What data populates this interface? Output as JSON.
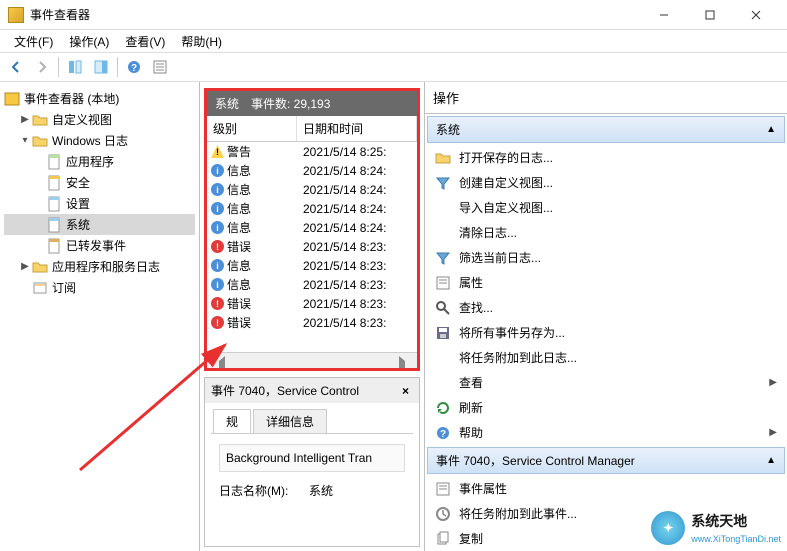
{
  "titlebar": {
    "title": "事件查看器"
  },
  "menubar": {
    "file": "文件(F)",
    "action": "操作(A)",
    "view": "查看(V)",
    "help": "帮助(H)"
  },
  "tree": {
    "root": "事件查看器 (本地)",
    "custom_views": "自定义视图",
    "windows_logs": "Windows 日志",
    "app_log": "应用程序",
    "security": "安全",
    "setup": "设置",
    "system": "系统",
    "forwarded": "已转发事件",
    "app_service_logs": "应用程序和服务日志",
    "subscriptions": "订阅"
  },
  "midheader": {
    "name": "系统",
    "count_label": "事件数: 29,193"
  },
  "columns": {
    "level": "级别",
    "datetime": "日期和时间"
  },
  "events": [
    {
      "lvl": "warn",
      "lvl_text": "警告",
      "dt": "2021/5/14 8:25:"
    },
    {
      "lvl": "info",
      "lvl_text": "信息",
      "dt": "2021/5/14 8:24:"
    },
    {
      "lvl": "info",
      "lvl_text": "信息",
      "dt": "2021/5/14 8:24:"
    },
    {
      "lvl": "info",
      "lvl_text": "信息",
      "dt": "2021/5/14 8:24:"
    },
    {
      "lvl": "info",
      "lvl_text": "信息",
      "dt": "2021/5/14 8:24:"
    },
    {
      "lvl": "err",
      "lvl_text": "错误",
      "dt": "2021/5/14 8:23:"
    },
    {
      "lvl": "info",
      "lvl_text": "信息",
      "dt": "2021/5/14 8:23:"
    },
    {
      "lvl": "info",
      "lvl_text": "信息",
      "dt": "2021/5/14 8:23:"
    },
    {
      "lvl": "err",
      "lvl_text": "错误",
      "dt": "2021/5/14 8:23:"
    },
    {
      "lvl": "err",
      "lvl_text": "错误",
      "dt": "2021/5/14 8:23:"
    }
  ],
  "detail": {
    "title": "事件 7040，Service Control",
    "tab_general": "规",
    "tab_details": "详细信息",
    "desc": "Background Intelligent Tran",
    "logname_label": "日志名称(M):",
    "logname_value": "系统"
  },
  "actions_header": "操作",
  "actions_group1": "系统",
  "actions1": [
    {
      "icon": "folder",
      "label": "打开保存的日志..."
    },
    {
      "icon": "filter",
      "label": "创建自定义视图..."
    },
    {
      "icon": "blank",
      "label": "导入自定义视图..."
    },
    {
      "icon": "blank",
      "label": "清除日志..."
    },
    {
      "icon": "filter",
      "label": "筛选当前日志..."
    },
    {
      "icon": "props",
      "label": "属性"
    },
    {
      "icon": "find",
      "label": "查找..."
    },
    {
      "icon": "save",
      "label": "将所有事件另存为..."
    },
    {
      "icon": "blank",
      "label": "将任务附加到此日志..."
    },
    {
      "icon": "blank",
      "label": "查看",
      "chev": true
    },
    {
      "icon": "refresh",
      "label": "刷新"
    },
    {
      "icon": "help",
      "label": "帮助",
      "chev": true
    }
  ],
  "actions_group2": "事件 7040，Service Control Manager",
  "actions2": [
    {
      "icon": "props",
      "label": "事件属性"
    },
    {
      "icon": "attach",
      "label": "将任务附加到此事件..."
    },
    {
      "icon": "copy",
      "label": "复制"
    }
  ],
  "watermark": {
    "brand": "系统天地",
    "url": "www.XiTongTianDi.net"
  }
}
